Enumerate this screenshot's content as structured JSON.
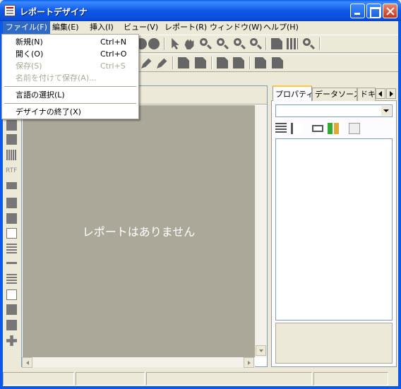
{
  "window": {
    "title": "レポートデザイナ"
  },
  "menubar": {
    "items": [
      {
        "label": "ファイル(F)"
      },
      {
        "label": "編集(E)"
      },
      {
        "label": "挿入(I)"
      },
      {
        "label": "ビュー(V)"
      },
      {
        "label": "レポート(R)"
      },
      {
        "label": "ウィンドウ(W)"
      },
      {
        "label": "ヘルプ(H)"
      }
    ]
  },
  "file_menu": {
    "new": {
      "label": "新規(N)",
      "shortcut": "Ctrl+N"
    },
    "open": {
      "label": "開く(O)",
      "shortcut": "Ctrl+O"
    },
    "save": {
      "label": "保存(S)",
      "shortcut": "Ctrl+S"
    },
    "save_as": {
      "label": "名前を付けて保存(A)..."
    },
    "language": {
      "label": "言語の選択(L)"
    },
    "exit": {
      "label": "デザイナの終了(X)"
    }
  },
  "design": {
    "empty_message": "レポートはありません"
  },
  "toolbox": {
    "rtf_label": "RTF"
  },
  "right_panel": {
    "tabs": [
      "プロパティ",
      "データソース",
      "ドキ"
    ],
    "combo_value": ""
  }
}
